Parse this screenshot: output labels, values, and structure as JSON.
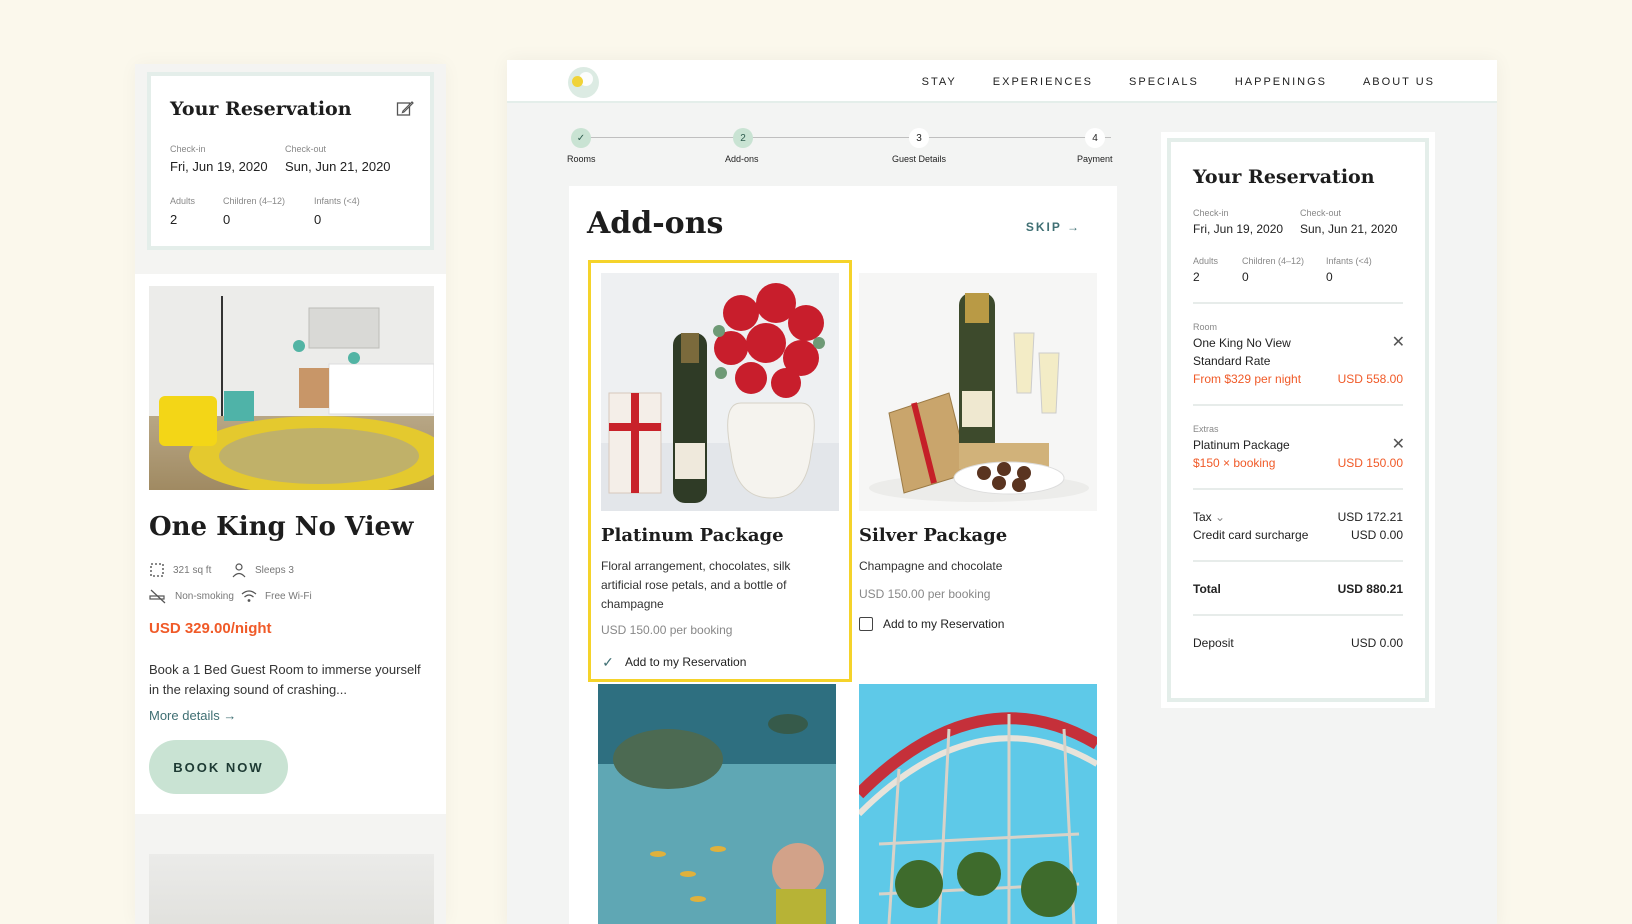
{
  "mobile": {
    "reservation": {
      "title": "Your Reservation",
      "check_in_label": "Check-in",
      "check_in": "Fri, Jun 19, 2020",
      "check_out_label": "Check-out",
      "check_out": "Sun, Jun 21, 2020",
      "adults_label": "Adults",
      "adults": "2",
      "children_label": "Children (4–12)",
      "children": "0",
      "infants_label": "Infants (<4)",
      "infants": "0"
    },
    "room": {
      "title": "One King No View",
      "size": "321 sq ft",
      "sleeps": "Sleeps 3",
      "smoking": "Non-smoking",
      "wifi": "Free Wi-Fi",
      "price": "USD 329.00/night",
      "description": "Book a 1 Bed Guest Room to immerse yourself in the relaxing sound of crashing...",
      "more_details": "More details →",
      "book_now": "BOOK NOW"
    }
  },
  "nav": {
    "items": [
      "STAY",
      "EXPERIENCES",
      "SPECIALS",
      "HAPPENINGS",
      "ABOUT US"
    ]
  },
  "steps": [
    {
      "num": "✓",
      "label": "Rooms"
    },
    {
      "num": "2",
      "label": "Add-ons"
    },
    {
      "num": "3",
      "label": "Guest Details"
    },
    {
      "num": "4",
      "label": "Payment"
    }
  ],
  "addons": {
    "heading": "Add-ons",
    "skip": "SKIP →",
    "packages": [
      {
        "title": "Platinum Package",
        "description": "Floral arrangement, chocolates, silk artificial rose petals, and a bottle of champagne",
        "price": "USD 150.00 per booking",
        "add_label": "Add to my Reservation",
        "checked": true
      },
      {
        "title": "Silver Package",
        "description": "Champagne and chocolate",
        "price": "USD 150.00 per booking",
        "add_label": "Add to my Reservation",
        "checked": false
      }
    ]
  },
  "summary": {
    "title": "Your Reservation",
    "check_in_label": "Check-in",
    "check_in": "Fri, Jun 19, 2020",
    "check_out_label": "Check-out",
    "check_out": "Sun, Jun 21, 2020",
    "adults_label": "Adults",
    "adults": "2",
    "children_label": "Children (4–12)",
    "children": "0",
    "infants_label": "Infants (<4)",
    "infants": "0",
    "room_label": "Room",
    "room_name": "One King No View",
    "room_rate": "Standard Rate",
    "room_price_note": "From $329 per night",
    "room_total": "USD 558.00",
    "extras_label": "Extras",
    "extra_name": "Platinum Package",
    "extra_price_note": "$150 × booking",
    "extra_total": "USD 150.00",
    "tax_label": "Tax",
    "tax_value": "USD 172.21",
    "surcharge_label": "Credit card surcharge",
    "surcharge_value": "USD 0.00",
    "total_label": "Total",
    "total_value": "USD  880.21",
    "deposit_label": "Deposit",
    "deposit_value": "USD 0.00"
  },
  "colors": {
    "accent_orange": "#f05a28",
    "teal_link": "#3f6f73",
    "mint": "#c9e3d3",
    "selected_border": "#f5d32a",
    "background": "#fbf8ec"
  }
}
